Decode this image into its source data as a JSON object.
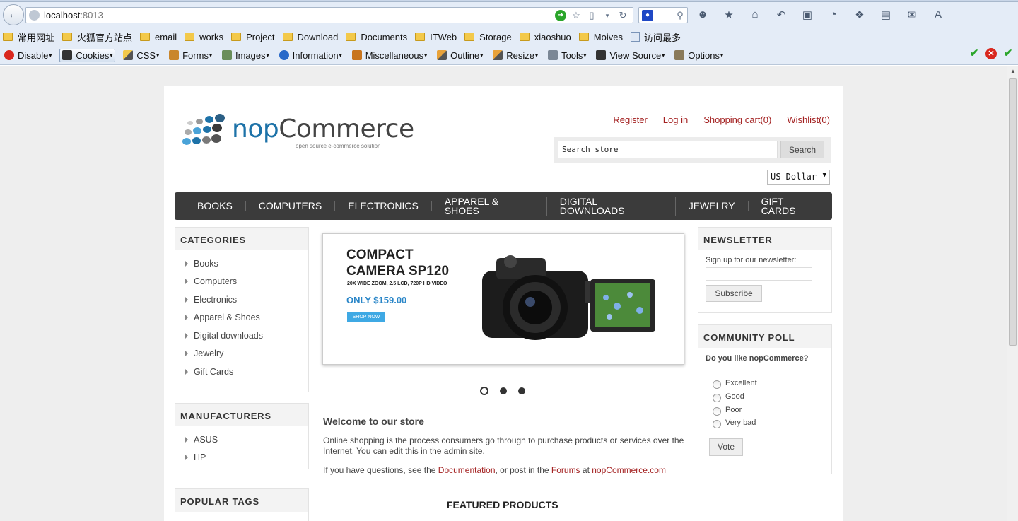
{
  "browser": {
    "url_host": "localhost",
    "url_port": ":8013",
    "bookmarks": [
      "常用网址",
      "火狐官方站点",
      "email",
      "works",
      "Project",
      "Download",
      "Documents",
      "ITWeb",
      "Storage",
      "xiaoshuo",
      "Moives",
      "访问最多"
    ],
    "devtools": [
      "Disable",
      "Cookies",
      "CSS",
      "Forms",
      "Images",
      "Information",
      "Miscellaneous",
      "Outline",
      "Resize",
      "Tools",
      "View Source",
      "Options"
    ]
  },
  "header": {
    "logo_word_a": "nop",
    "logo_word_b": "Commerce",
    "logo_tagline": "open source e-commerce solution",
    "links": [
      "Register",
      "Log in",
      "Shopping cart(0)",
      "Wishlist(0)"
    ],
    "search_placeholder": "Search store",
    "search_button": "Search",
    "currency": "US Dollar"
  },
  "menu": [
    "BOOKS",
    "COMPUTERS",
    "ELECTRONICS",
    "APPAREL & SHOES",
    "DIGITAL DOWNLOADS",
    "JEWELRY",
    "GIFT CARDS"
  ],
  "categories": {
    "title": "CATEGORIES",
    "items": [
      "Books",
      "Computers",
      "Electronics",
      "Apparel & Shoes",
      "Digital downloads",
      "Jewelry",
      "Gift Cards"
    ]
  },
  "manufacturers": {
    "title": "MANUFACTURERS",
    "items": [
      "ASUS",
      "HP"
    ]
  },
  "popular_tags": {
    "title": "POPULAR TAGS"
  },
  "slider": {
    "line1": "COMPACT",
    "line2": "CAMERA SP120",
    "sub": "20X WIDE ZOOM, 2.5 LCD, 720P HD VIDEO",
    "price": "ONLY $159.00",
    "cta": "SHOP NOW",
    "active_dot": 1,
    "dot_count": 3
  },
  "welcome": {
    "title": "Welcome to our store",
    "para1": "Online shopping is the process consumers go through to purchase products or services over the Internet. You can edit this in the admin site.",
    "para2_a": "If you have questions, see the ",
    "link_doc": "Documentation",
    "para2_b": ", or post in the ",
    "link_forums": "Forums",
    "para2_c": " at ",
    "link_site": "nopCommerce.com"
  },
  "featured_title": "FEATURED PRODUCTS",
  "newsletter": {
    "title": "NEWSLETTER",
    "label": "Sign up for our newsletter:",
    "button": "Subscribe"
  },
  "poll": {
    "title": "COMMUNITY POLL",
    "question": "Do you like nopCommerce?",
    "options": [
      "Excellent",
      "Good",
      "Poor",
      "Very bad"
    ],
    "button": "Vote"
  },
  "colors": {
    "accent_link": "#a32020",
    "menu_bg": "#3b3b3b",
    "logo_blue": "#1d72a8"
  }
}
